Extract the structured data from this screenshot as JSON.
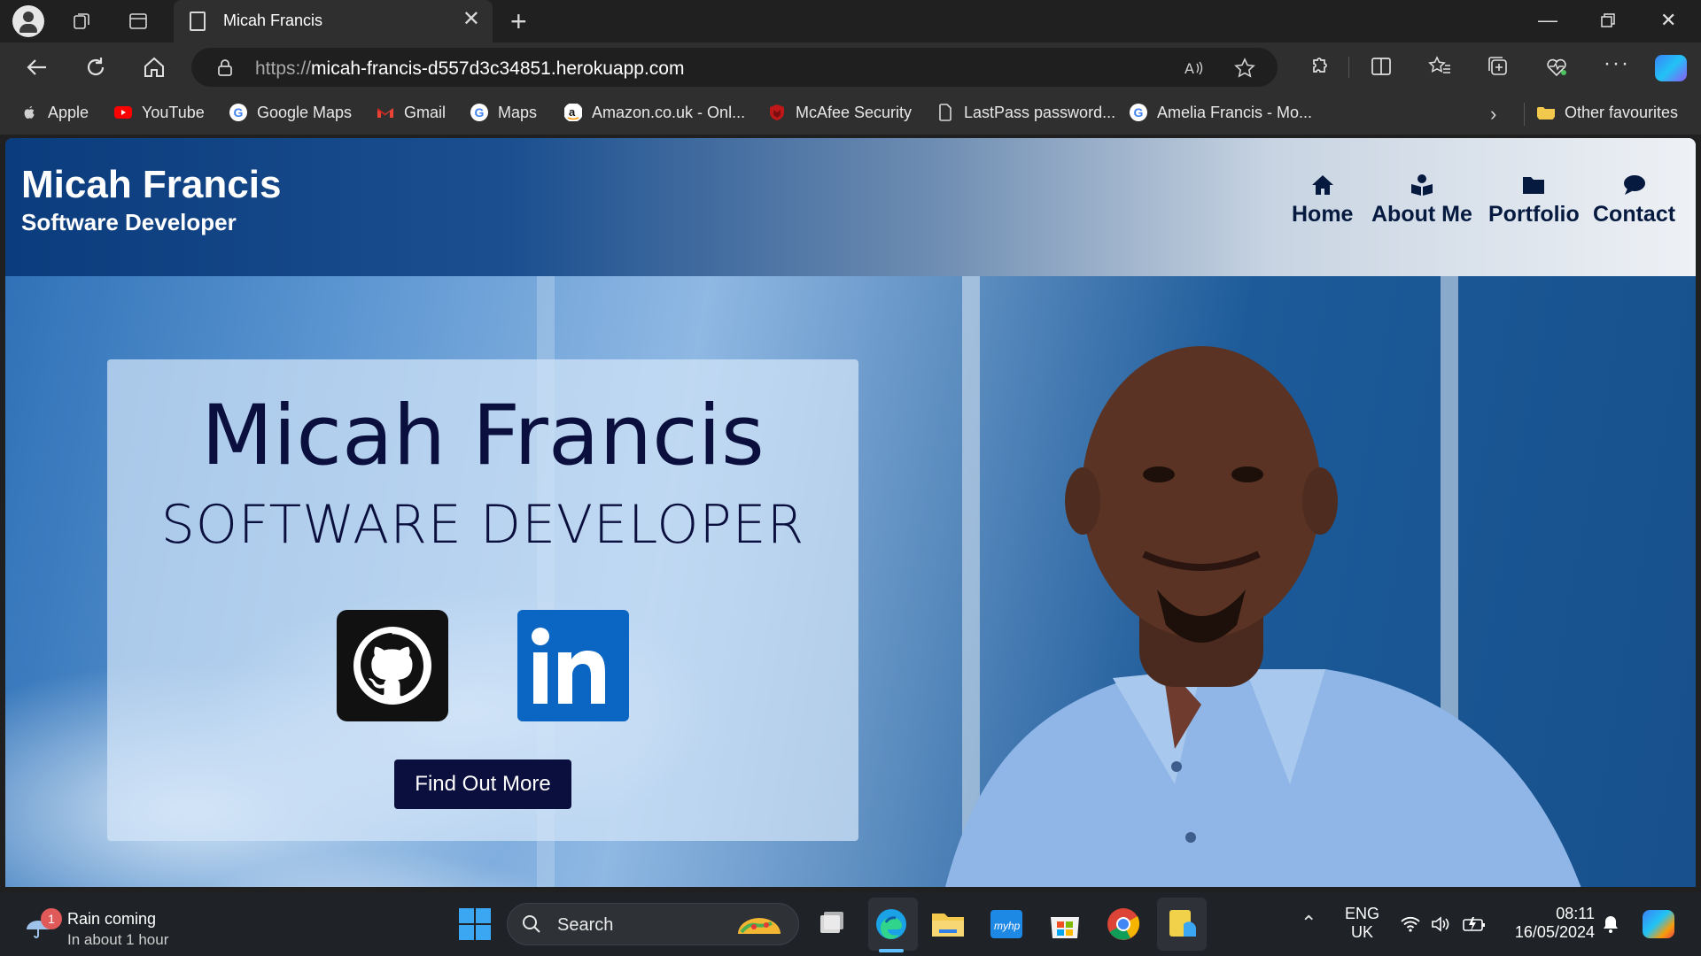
{
  "browser": {
    "tab_title": "Micah Francis",
    "url_scheme": "https://",
    "url_host": "micah-francis-d557d3c34851.herokuapp.com"
  },
  "bookmarks": [
    {
      "label": "Apple",
      "icon": "apple-icon"
    },
    {
      "label": "YouTube",
      "icon": "youtube-icon"
    },
    {
      "label": "Google Maps",
      "icon": "google-icon"
    },
    {
      "label": "Gmail",
      "icon": "gmail-icon"
    },
    {
      "label": "Maps",
      "icon": "google-icon"
    },
    {
      "label": "Amazon.co.uk - Onl...",
      "icon": "amazon-icon"
    },
    {
      "label": "McAfee Security",
      "icon": "mcafee-icon"
    },
    {
      "label": "LastPass password...",
      "icon": "page-icon"
    },
    {
      "label": "Amelia Francis - Mo...",
      "icon": "google-icon"
    }
  ],
  "other_favourites": "Other favourites",
  "site": {
    "brand_title": "Micah Francis",
    "brand_subtitle": "Software Developer",
    "nav": [
      {
        "label": "Home",
        "icon": "home-icon"
      },
      {
        "label": "About Me",
        "icon": "reader-icon"
      },
      {
        "label": "Portfolio",
        "icon": "folder-icon"
      },
      {
        "label": "Contact",
        "icon": "chat-icon"
      }
    ],
    "hero": {
      "name": "Micah Francis",
      "role": "SOFTWARE DEVELOPER",
      "cta": "Find Out More",
      "social": [
        {
          "label": "GitHub",
          "icon": "github-icon"
        },
        {
          "label": "LinkedIn",
          "icon": "linkedin-icon"
        }
      ]
    }
  },
  "taskbar": {
    "weather_badge": "1",
    "weather_line1": "Rain coming",
    "weather_line2": "In about 1 hour",
    "search_label": "Search",
    "lang_line1": "ENG",
    "lang_line2": "UK",
    "time": "08:11",
    "date": "16/05/2024"
  },
  "colors": {
    "brand_navy": "#0a0f3d",
    "header_blue": "#0b3c7d",
    "linkedin_blue": "#0a66c2"
  }
}
